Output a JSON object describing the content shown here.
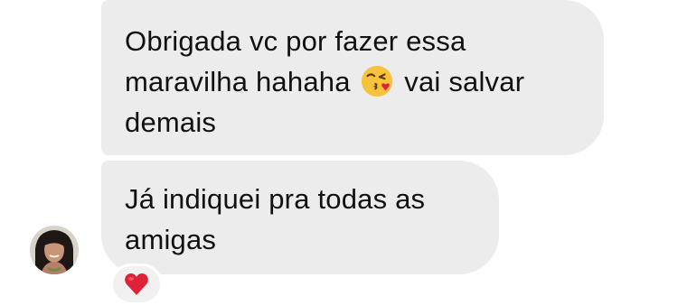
{
  "messages": [
    {
      "text_before_emoji": "Obrigada vc por fazer essa\nmaravilha hahaha ",
      "emoji": "kissing-face-with-heart-icon",
      "text_after_emoji": " vai salvar\ndemais"
    },
    {
      "text": "Já indiquei pra todas as\namigas",
      "reaction": "heart-icon"
    }
  ],
  "colors": {
    "bubble": "#ececec",
    "text": "#111111",
    "heart": "#e0213a"
  }
}
